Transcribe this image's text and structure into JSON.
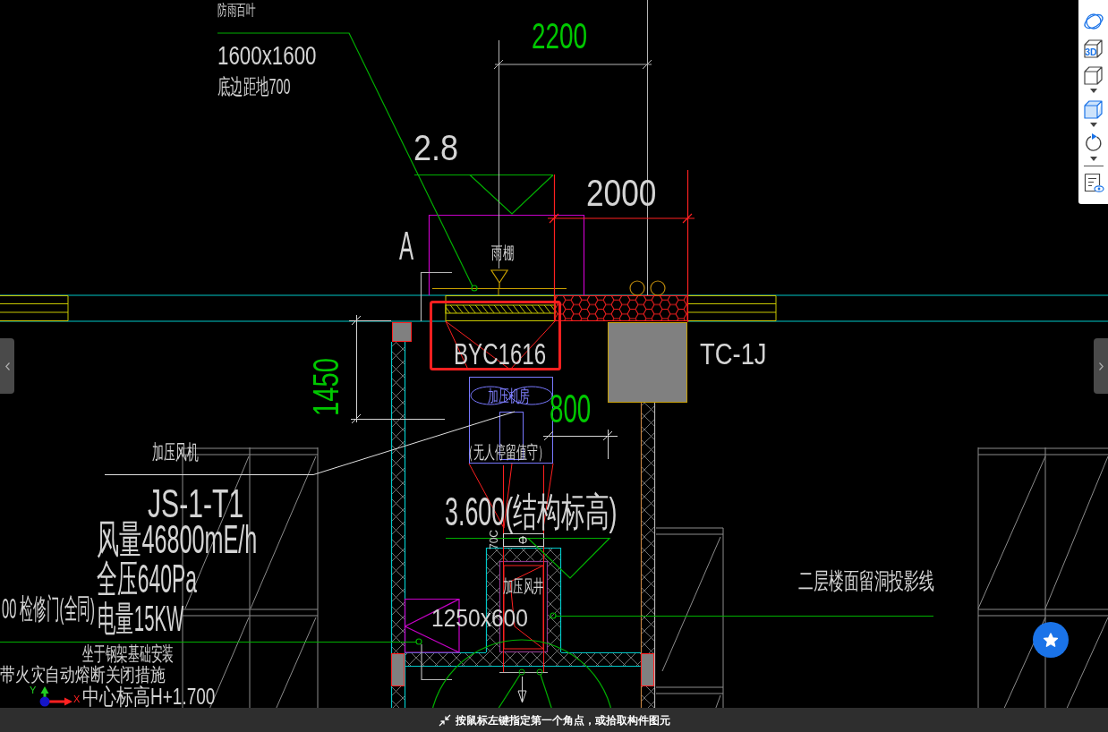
{
  "drawing": {
    "labels": [
      {
        "text": "防雨百叶",
        "color": "#d4d4d4"
      },
      {
        "text": "2200",
        "color": "#00c800"
      },
      {
        "text": "1600x1600",
        "color": "#d4d4d4"
      },
      {
        "text": "底边距地700",
        "color": "#d4d4d4"
      },
      {
        "text": "2.8",
        "color": "#d4d4d4"
      },
      {
        "text": "2000",
        "color": "#d4d4d4"
      },
      {
        "text": "A",
        "color": "#d4d4d4"
      },
      {
        "text": "雨棚",
        "color": "#d4d4d4"
      },
      {
        "text": "BYC1616",
        "color": "#d4d4d4"
      },
      {
        "text": "TC-1J",
        "color": "#d4d4d4"
      },
      {
        "text": "1450",
        "color": "#00c800"
      },
      {
        "text": "加压机房",
        "color": "#8080ff"
      },
      {
        "text": "800",
        "color": "#00c800"
      },
      {
        "text": "（无人停留值守）",
        "color": "#d4d4d4"
      },
      {
        "text": "加压风机",
        "color": "#d4d4d4"
      },
      {
        "text": "JS-1-T1",
        "color": "#d4d4d4"
      },
      {
        "text": "3.600(结构标高)",
        "color": "#d4d4d4"
      },
      {
        "text": "风量46800mE/h",
        "color": "#d4d4d4"
      },
      {
        "text": "70C",
        "color": "#d4d4d4"
      },
      {
        "text": "Φ",
        "color": "#d4d4d4"
      },
      {
        "text": "全压640Pa",
        "color": "#d4d4d4"
      },
      {
        "text": "二层楼面留洞投影线",
        "color": "#d4d4d4"
      },
      {
        "text": "00 检修门(全同)",
        "color": "#d4d4d4"
      },
      {
        "text": "电量15KW",
        "color": "#d4d4d4"
      },
      {
        "text": "1250x600",
        "color": "#d4d4d4"
      },
      {
        "text": "加压风井",
        "color": "#d4d4d4"
      },
      {
        "text": "坐于钢架基础安装",
        "color": "#d4d4d4"
      },
      {
        "text": "带火灾自动熔断关闭措施",
        "color": "#d4d4d4"
      },
      {
        "text": "中心标高H+1.700",
        "color": "#d4d4d4"
      }
    ]
  },
  "ucs": {
    "y_label": "Y",
    "x_label": "X"
  },
  "view_toolbar": {
    "tools": [
      {
        "kind": "orbit",
        "dropdown": false
      },
      {
        "kind": "view-3d",
        "label": "3D",
        "dropdown": false
      },
      {
        "kind": "wireframe",
        "dropdown": true
      },
      {
        "kind": "shaded",
        "dropdown": true
      },
      {
        "kind": "rotate",
        "dropdown": true
      },
      {
        "kind": "properties",
        "dropdown": false
      }
    ]
  },
  "status_bar": {
    "hint": "按鼠标左键指定第一个角点，或拾取构件图元"
  }
}
